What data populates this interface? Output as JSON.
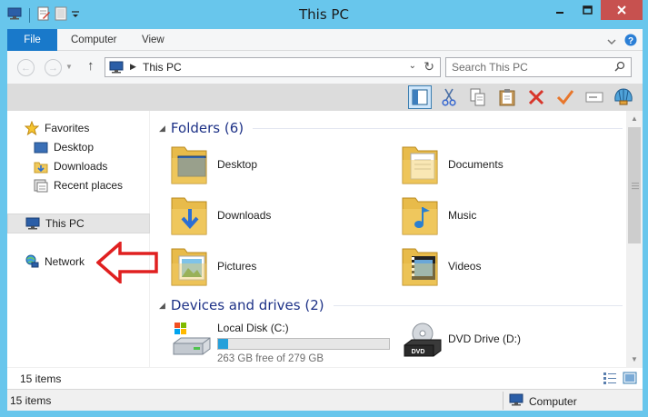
{
  "window": {
    "title": "This PC"
  },
  "ribbon": {
    "tabs": [
      "File",
      "Computer",
      "View"
    ]
  },
  "address": {
    "path": "This PC",
    "search_placeholder": "Search This PC"
  },
  "nav": {
    "favorites": "Favorites",
    "desktop": "Desktop",
    "downloads": "Downloads",
    "recent": "Recent places",
    "this_pc": "This PC",
    "network": "Network"
  },
  "folders": {
    "header": "Folders (6)",
    "items": [
      "Desktop",
      "Documents",
      "Downloads",
      "Music",
      "Pictures",
      "Videos"
    ]
  },
  "drives": {
    "header": "Devices and drives (2)",
    "local_name": "Local Disk (C:)",
    "local_free": "263 GB free of 279 GB",
    "local_used_fraction": 0.057,
    "dvd_name": "DVD Drive (D:)"
  },
  "status": {
    "items_inner": "15 items",
    "items_outer": "15 items",
    "zone": "Computer"
  },
  "colors": {
    "title_bar": "#68c6ec",
    "file_tab": "#1979ca",
    "drive_bar": "#26a0da",
    "group_header": "#1e3287",
    "annotation_arrow": "#e02020"
  }
}
